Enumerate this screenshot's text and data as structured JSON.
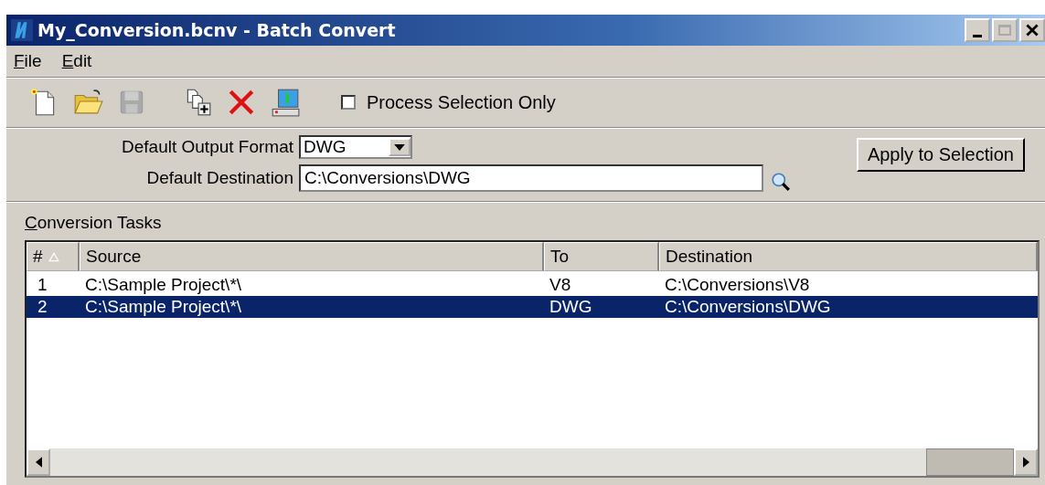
{
  "window": {
    "title": "My_Conversion.bcnv - Batch Convert"
  },
  "menu": [
    {
      "label": "File"
    },
    {
      "label": "Edit"
    }
  ],
  "toolbar": {
    "process_selection_only": {
      "label": "Process Selection Only",
      "checked": false
    }
  },
  "form": {
    "output_format": {
      "label": "Default Output Format",
      "value": "DWG"
    },
    "destination": {
      "label": "Default Destination",
      "value": "C:\\Conversions\\DWG"
    },
    "apply_button": "Apply to Selection"
  },
  "tasks": {
    "label": "Conversion Tasks",
    "columns": [
      {
        "label": "#",
        "sorted": true
      },
      {
        "label": "Source",
        "sorted": false
      },
      {
        "label": "To",
        "sorted": false
      },
      {
        "label": "Destination",
        "sorted": false
      }
    ],
    "rows": [
      {
        "cells": [
          "1",
          "C:\\Sample Project\\*\\",
          "V8",
          "C:\\Conversions\\V8"
        ],
        "selected": false
      },
      {
        "cells": [
          "2",
          "C:\\Sample Project\\*\\",
          "DWG",
          "C:\\Conversions\\DWG"
        ],
        "selected": true
      }
    ]
  }
}
